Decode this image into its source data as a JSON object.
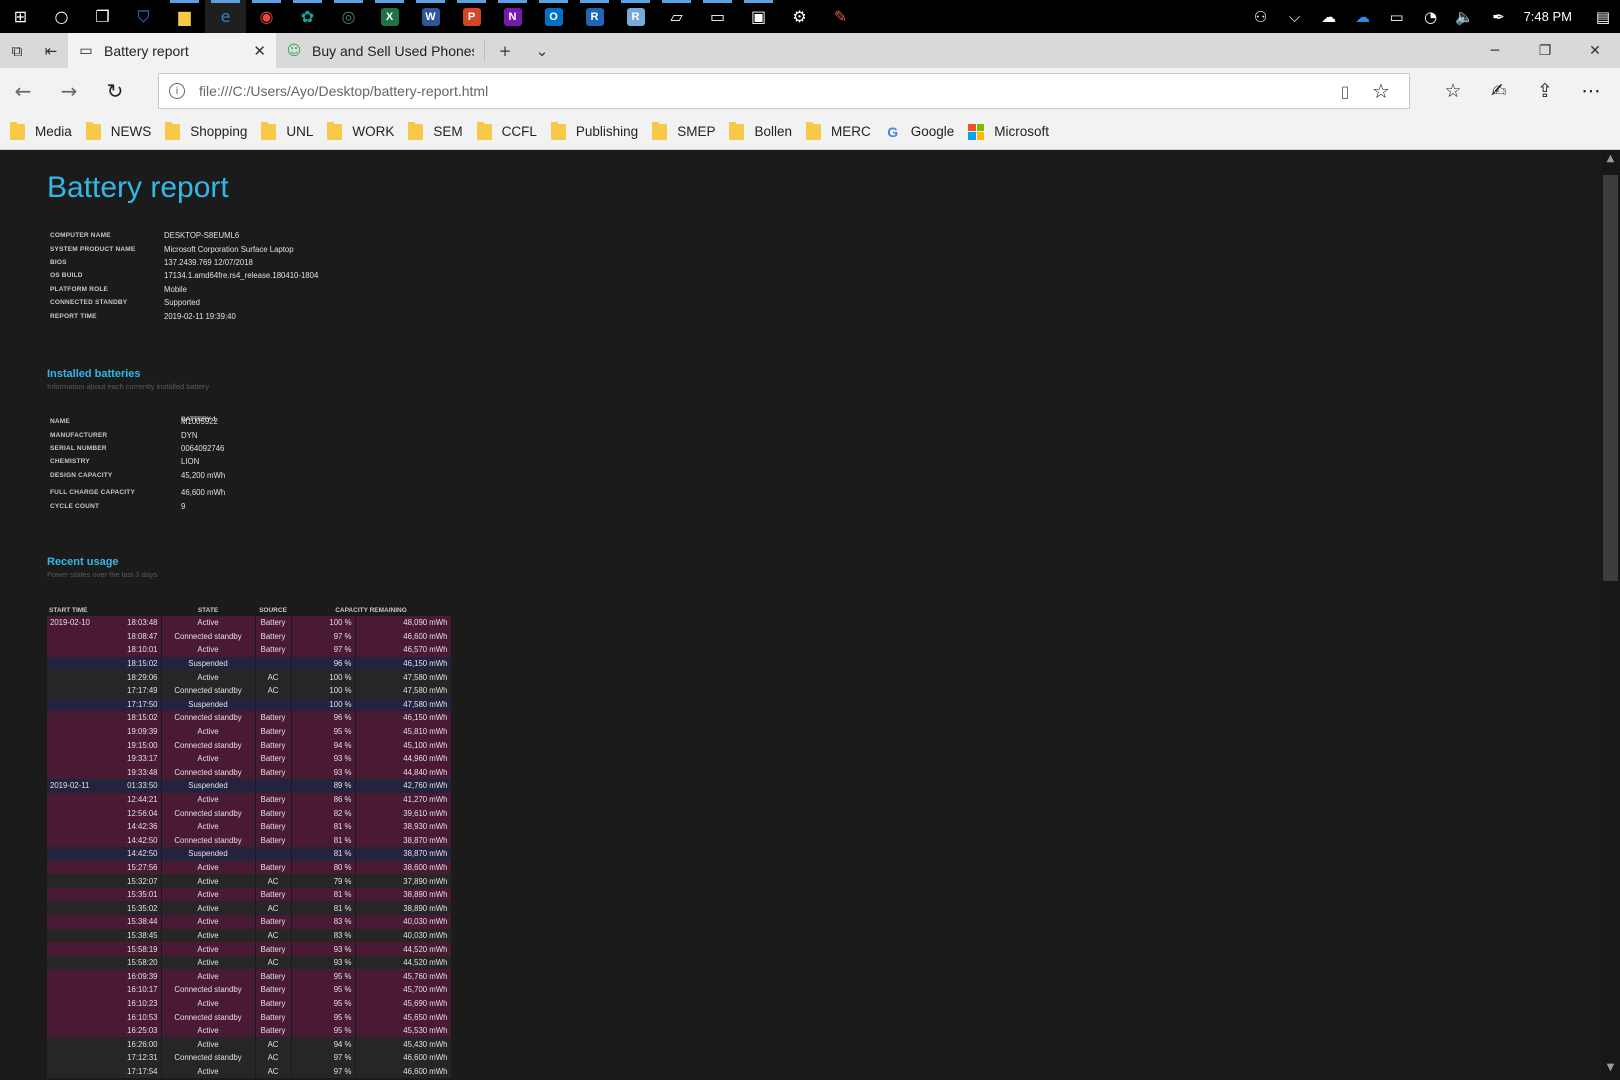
{
  "taskbar": {
    "apps": [
      {
        "name": "start-icon",
        "glyph": "⊞"
      },
      {
        "name": "cortana-icon",
        "glyph": "○"
      },
      {
        "name": "task-view-icon",
        "glyph": "❐"
      },
      {
        "name": "store-icon",
        "glyph": "⛉",
        "color": "#3a86d6"
      },
      {
        "name": "file-explorer-icon",
        "glyph": "▆",
        "color": "#f7c948"
      },
      {
        "name": "edge-icon",
        "glyph": "e",
        "color": "#2f7fd4"
      },
      {
        "name": "chrome-icon",
        "glyph": "◉",
        "color": "#e8453c"
      },
      {
        "name": "app-teal-icon",
        "glyph": "✿",
        "color": "#13a89e"
      },
      {
        "name": "app-green-icon",
        "glyph": "◎",
        "color": "#4a8a5c"
      },
      {
        "name": "excel-icon",
        "glyph": "X",
        "color": "#1f7244"
      },
      {
        "name": "word-icon",
        "glyph": "W",
        "color": "#2b579a"
      },
      {
        "name": "powerpoint-icon",
        "glyph": "P",
        "color": "#d24726"
      },
      {
        "name": "onenote-icon",
        "glyph": "N",
        "color": "#7719aa"
      },
      {
        "name": "outlook-icon",
        "glyph": "O",
        "color": "#0072c6"
      },
      {
        "name": "r-icon",
        "glyph": "R",
        "color": "#2165b6"
      },
      {
        "name": "rstudio-icon",
        "glyph": "R",
        "color": "#75aadb"
      },
      {
        "name": "tablet-icon",
        "glyph": "▱"
      },
      {
        "name": "terminal-icon",
        "glyph": "▭"
      },
      {
        "name": "device-icon",
        "glyph": "▣"
      },
      {
        "name": "settings-icon",
        "glyph": "⚙"
      },
      {
        "name": "paint-icon",
        "glyph": "✎",
        "color": "#e05a4a"
      }
    ],
    "tray": [
      {
        "name": "people-icon",
        "glyph": "⚇"
      },
      {
        "name": "chevron-up-icon",
        "glyph": "⌵"
      },
      {
        "name": "onedrive-white-icon",
        "glyph": "☁"
      },
      {
        "name": "onedrive-blue-icon",
        "glyph": "☁",
        "color": "#2f8be6"
      },
      {
        "name": "battery-icon",
        "glyph": "▭"
      },
      {
        "name": "wifi-icon",
        "glyph": "◔"
      },
      {
        "name": "volume-icon",
        "glyph": "🔈"
      },
      {
        "name": "pen-icon",
        "glyph": "✒"
      }
    ],
    "clock": "7:48 PM",
    "notifications_glyph": "▤"
  },
  "tabs": [
    {
      "title": "Battery report",
      "active": true
    },
    {
      "title": "Buy and Sell Used Phones, I",
      "active": false
    }
  ],
  "address": {
    "url": "file:///C:/Users/Ayo/Desktop/battery-report.html"
  },
  "favorites": [
    {
      "label": "Media",
      "type": "folder"
    },
    {
      "label": "NEWS",
      "type": "folder"
    },
    {
      "label": "Shopping",
      "type": "folder"
    },
    {
      "label": "UNL",
      "type": "folder"
    },
    {
      "label": "WORK",
      "type": "folder"
    },
    {
      "label": "SEM",
      "type": "folder"
    },
    {
      "label": "CCFL",
      "type": "folder"
    },
    {
      "label": "Publishing",
      "type": "folder"
    },
    {
      "label": "SMEP",
      "type": "folder"
    },
    {
      "label": "Bollen",
      "type": "folder"
    },
    {
      "label": "MERC",
      "type": "folder"
    },
    {
      "label": "Google",
      "type": "google"
    },
    {
      "label": "Microsoft",
      "type": "microsoft"
    }
  ],
  "report": {
    "title": "Battery report",
    "system_info": [
      {
        "key": "COMPUTER NAME",
        "value": "DESKTOP-S8EUML6"
      },
      {
        "key": "SYSTEM PRODUCT NAME",
        "value": "Microsoft Corporation Surface Laptop"
      },
      {
        "key": "BIOS",
        "value": "137.2439.769 12/07/2018"
      },
      {
        "key": "OS BUILD",
        "value": "17134.1.amd64fre.rs4_release.180410-1804"
      },
      {
        "key": "PLATFORM ROLE",
        "value": "Mobile"
      },
      {
        "key": "CONNECTED STANDBY",
        "value": "Supported"
      },
      {
        "key": "REPORT TIME",
        "value": "2019-02-11  19:39:40"
      }
    ],
    "installed_batteries": {
      "title": "Installed batteries",
      "subtitle": "Information about each currently installed battery",
      "column": "BATTERY 1",
      "rows": [
        {
          "key": "NAME",
          "value": "M1005922"
        },
        {
          "key": "MANUFACTURER",
          "value": "DYN"
        },
        {
          "key": "SERIAL NUMBER",
          "value": "0064092746"
        },
        {
          "key": "CHEMISTRY",
          "value": "LION"
        },
        {
          "key": "DESIGN CAPACITY",
          "value": "45,200 mWh"
        },
        {
          "key": "FULL CHARGE CAPACITY",
          "value": "46,600 mWh"
        },
        {
          "key": "CYCLE COUNT",
          "value": "9"
        }
      ]
    },
    "recent_usage": {
      "title": "Recent usage",
      "subtitle": "Power states over the last 3 days",
      "headers": [
        "START TIME",
        "STATE",
        "SOURCE",
        "CAPACITY REMAINING"
      ],
      "rows": [
        {
          "date": "2019-02-10",
          "time": "18:03:48",
          "state": "Active",
          "source": "Battery",
          "pct": "100 %",
          "cap": "48,090 mWh"
        },
        {
          "date": "",
          "time": "18:08:47",
          "state": "Connected standby",
          "source": "Battery",
          "pct": "97 %",
          "cap": "46,600 mWh"
        },
        {
          "date": "",
          "time": "18:10:01",
          "state": "Active",
          "source": "Battery",
          "pct": "97 %",
          "cap": "46,570 mWh"
        },
        {
          "date": "",
          "time": "18:15:02",
          "state": "Suspended",
          "source": "",
          "pct": "96 %",
          "cap": "46,150 mWh"
        },
        {
          "date": "",
          "time": "18:29:06",
          "state": "Active",
          "source": "AC",
          "pct": "100 %",
          "cap": "47,580 mWh"
        },
        {
          "date": "",
          "time": "17:17:49",
          "state": "Connected standby",
          "source": "AC",
          "pct": "100 %",
          "cap": "47,580 mWh"
        },
        {
          "date": "",
          "time": "17:17:50",
          "state": "Suspended",
          "source": "",
          "pct": "100 %",
          "cap": "47,580 mWh"
        },
        {
          "date": "",
          "time": "18:15:02",
          "state": "Connected standby",
          "source": "Battery",
          "pct": "96 %",
          "cap": "46,150 mWh"
        },
        {
          "date": "",
          "time": "19:09:39",
          "state": "Active",
          "source": "Battery",
          "pct": "95 %",
          "cap": "45,810 mWh"
        },
        {
          "date": "",
          "time": "19:15:00",
          "state": "Connected standby",
          "source": "Battery",
          "pct": "94 %",
          "cap": "45,100 mWh"
        },
        {
          "date": "",
          "time": "19:33:17",
          "state": "Active",
          "source": "Battery",
          "pct": "93 %",
          "cap": "44,960 mWh"
        },
        {
          "date": "",
          "time": "19:33:48",
          "state": "Connected standby",
          "source": "Battery",
          "pct": "93 %",
          "cap": "44,840 mWh"
        },
        {
          "date": "2019-02-11",
          "time": "01:33:50",
          "state": "Suspended",
          "source": "",
          "pct": "89 %",
          "cap": "42,760 mWh"
        },
        {
          "date": "",
          "time": "12:44:21",
          "state": "Active",
          "source": "Battery",
          "pct": "86 %",
          "cap": "41,270 mWh"
        },
        {
          "date": "",
          "time": "12:56:04",
          "state": "Connected standby",
          "source": "Battery",
          "pct": "82 %",
          "cap": "39,610 mWh"
        },
        {
          "date": "",
          "time": "14:42:36",
          "state": "Active",
          "source": "Battery",
          "pct": "81 %",
          "cap": "38,930 mWh"
        },
        {
          "date": "",
          "time": "14:42:50",
          "state": "Connected standby",
          "source": "Battery",
          "pct": "81 %",
          "cap": "38,870 mWh"
        },
        {
          "date": "",
          "time": "14:42:50",
          "state": "Suspended",
          "source": "",
          "pct": "81 %",
          "cap": "38,870 mWh"
        },
        {
          "date": "",
          "time": "15:27:56",
          "state": "Active",
          "source": "Battery",
          "pct": "80 %",
          "cap": "38,600 mWh"
        },
        {
          "date": "",
          "time": "15:32:07",
          "state": "Active",
          "source": "AC",
          "pct": "79 %",
          "cap": "37,890 mWh"
        },
        {
          "date": "",
          "time": "15:35:01",
          "state": "Active",
          "source": "Battery",
          "pct": "81 %",
          "cap": "38,890 mWh"
        },
        {
          "date": "",
          "time": "15:35:02",
          "state": "Active",
          "source": "AC",
          "pct": "81 %",
          "cap": "38,890 mWh"
        },
        {
          "date": "",
          "time": "15:38:44",
          "state": "Active",
          "source": "Battery",
          "pct": "83 %",
          "cap": "40,030 mWh"
        },
        {
          "date": "",
          "time": "15:38:45",
          "state": "Active",
          "source": "AC",
          "pct": "83 %",
          "cap": "40,030 mWh"
        },
        {
          "date": "",
          "time": "15:58:19",
          "state": "Active",
          "source": "Battery",
          "pct": "93 %",
          "cap": "44,520 mWh"
        },
        {
          "date": "",
          "time": "15:58:20",
          "state": "Active",
          "source": "AC",
          "pct": "93 %",
          "cap": "44,520 mWh"
        },
        {
          "date": "",
          "time": "16:09:39",
          "state": "Active",
          "source": "Battery",
          "pct": "95 %",
          "cap": "45,760 mWh"
        },
        {
          "date": "",
          "time": "16:10:17",
          "state": "Connected standby",
          "source": "Battery",
          "pct": "95 %",
          "cap": "45,700 mWh"
        },
        {
          "date": "",
          "time": "16:10:23",
          "state": "Active",
          "source": "Battery",
          "pct": "95 %",
          "cap": "45,690 mWh"
        },
        {
          "date": "",
          "time": "16:10:53",
          "state": "Connected standby",
          "source": "Battery",
          "pct": "95 %",
          "cap": "45,650 mWh"
        },
        {
          "date": "",
          "time": "16:25:03",
          "state": "Active",
          "source": "Battery",
          "pct": "95 %",
          "cap": "45,530 mWh"
        },
        {
          "date": "",
          "time": "16:26:00",
          "state": "Active",
          "source": "AC",
          "pct": "94 %",
          "cap": "45,430 mWh"
        },
        {
          "date": "",
          "time": "17:12:31",
          "state": "Connected standby",
          "source": "AC",
          "pct": "97 %",
          "cap": "46,600 mWh"
        },
        {
          "date": "",
          "time": "17:17:54",
          "state": "Active",
          "source": "AC",
          "pct": "97 %",
          "cap": "46,600 mWh"
        }
      ]
    }
  },
  "colors": {
    "accent": "#33b8e6",
    "battery_row": "#4a1a35",
    "ac_row": "#262626",
    "suspended_row": "#232340"
  }
}
